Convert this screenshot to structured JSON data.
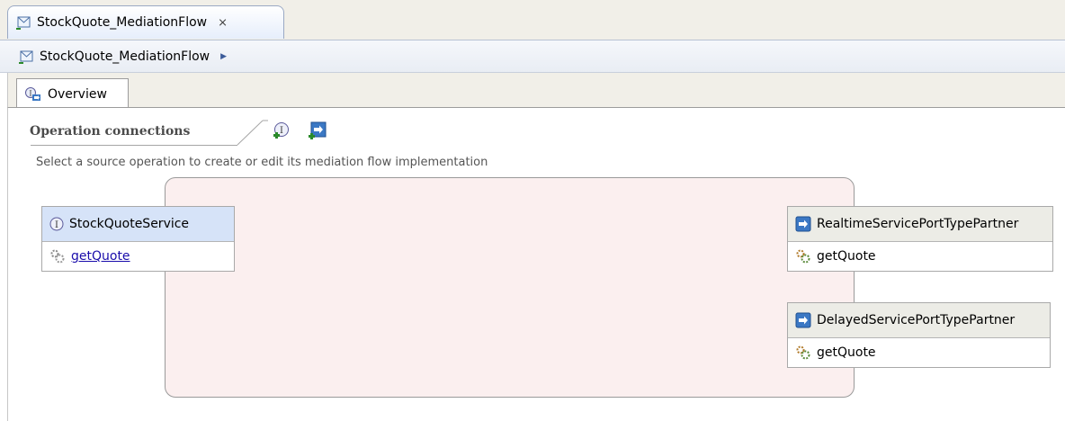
{
  "editor_tab": {
    "title": "StockQuote_MediationFlow",
    "close_glyph": "⨯"
  },
  "breadcrumb": {
    "item": "StockQuote_MediationFlow",
    "arrow": "▶"
  },
  "page_tab": {
    "label": "Overview"
  },
  "section": {
    "title": "Operation connections",
    "description": "Select a source operation to create or edit its mediation flow implementation"
  },
  "source": {
    "name": "StockQuoteService",
    "interface_glyph": "I",
    "operation": "getQuote"
  },
  "targets": [
    {
      "name": "RealtimeServicePortTypePartner",
      "operation": "getQuote"
    },
    {
      "name": "DelayedServicePortTypePartner",
      "operation": "getQuote"
    }
  ],
  "icons": {
    "tab": "mediation-flow-icon",
    "add_interface": "add-interface-icon",
    "add_reference": "add-reference-icon",
    "operation": "operation-gear-icon",
    "reference": "reference-arrow-icon"
  },
  "colors": {
    "flow_area": "#fbefef",
    "source_header": "#d6e3f8",
    "target_header": "#ecece6",
    "link": "#1a0dab"
  }
}
